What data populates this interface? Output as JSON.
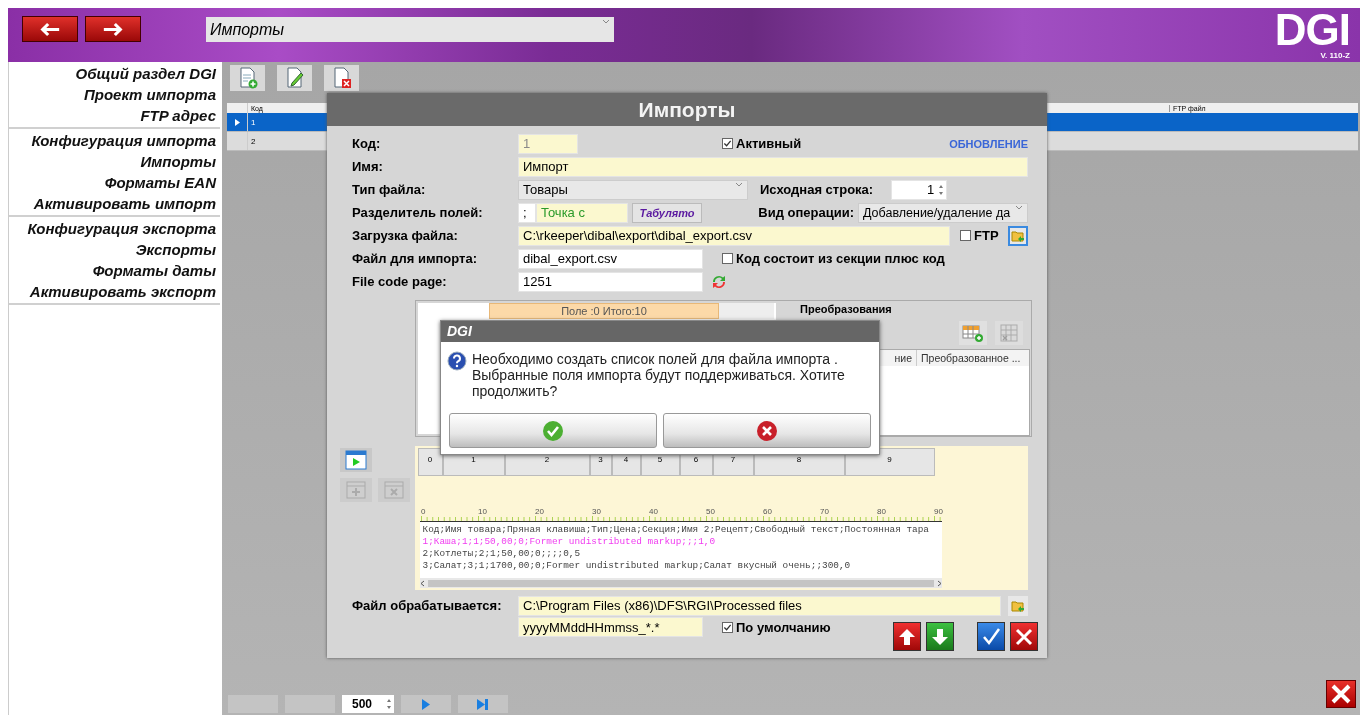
{
  "section_dropdown": {
    "value": "Импорты"
  },
  "logo": {
    "text": "DGI",
    "version": "V. 110-Z"
  },
  "sidebar": {
    "groups": [
      {
        "items": [
          "Общий раздел DGI",
          "Проект импорта",
          "FTP адрес"
        ]
      },
      {
        "items": [
          "Конфигурация импорта",
          "Импорты",
          "Форматы EAN",
          "Активировать импорт"
        ]
      },
      {
        "items": [
          "Конфигурация экспорта",
          "Экспорты",
          "Форматы даты",
          "Активировать экспорт"
        ]
      }
    ]
  },
  "grid": {
    "columns": [
      "Код",
      "FTP файл"
    ],
    "rows": [
      {
        "code": "1",
        "selected": true
      },
      {
        "code": "2",
        "selected": false
      }
    ]
  },
  "pagination": {
    "page_size": "500"
  },
  "edit_window": {
    "title": "Импорты",
    "code": {
      "label": "Код:",
      "value": "1"
    },
    "active": {
      "label": "Активный",
      "checked": true
    },
    "update_link": "ОБНОВЛЕНИЕ",
    "name": {
      "label": "Имя:",
      "value": "Импорт"
    },
    "file_type": {
      "label": "Тип файла:",
      "value": "Товары"
    },
    "start_row": {
      "label": "Исходная строка:",
      "value": "1"
    },
    "separator": {
      "label": "Разделитель полей:",
      "value": ";",
      "name": "Точка с",
      "tab_button": "Табулято"
    },
    "operation": {
      "label": "Вид операции:",
      "value": "Добавление/удаление да"
    },
    "file_load": {
      "label": "Загрузка файла:",
      "value": "C:\\rkeeper\\dibal\\export\\dibal_export.csv"
    },
    "ftp": {
      "label": "FTP",
      "checked": false
    },
    "import_file": {
      "label": "Файл для импорта:",
      "value": "dibal_export.csv"
    },
    "section_code": {
      "label": "Код состоит из секции плюс код",
      "checked": false
    },
    "code_page": {
      "label": "File code page:",
      "value": "1251"
    },
    "fields_header": "Поле :0 Итого:10",
    "transforms": {
      "title": "Преобразования",
      "columns": [
        "ние",
        "Преобразованное ..."
      ]
    },
    "column_markers": [
      "0",
      "1",
      "2",
      "3",
      "4",
      "5",
      "6",
      "7",
      "8",
      "9"
    ],
    "ruler_labels": [
      "0",
      "10",
      "20",
      "30",
      "40",
      "50",
      "60",
      "70",
      "80",
      "90"
    ],
    "preview_lines": [
      {
        "text": "Код;Имя товара;Пряная клавиша;Тип;Цена;Секция;Имя 2;Рецепт;Свободный текст;Постоянная тара",
        "highlighted": false
      },
      {
        "text": "1;Каша;1;1;50,00;0;Former undistributed markup;;;1,0",
        "highlighted": true
      },
      {
        "text": "2;Котлеты;2;1;50,00;0;;;;0,5",
        "highlighted": false
      },
      {
        "text": "3;Салат;3;1;1700,00;0;Former undistributed markup;Салат вкусный очень;;300,0",
        "highlighted": false
      }
    ],
    "processed": {
      "label": "Файл обрабатывается:",
      "value": "C:\\Program Files (x86)\\DFS\\RGI\\Processed files"
    },
    "mask": {
      "value": "yyyyMMddHHmmss_*.*"
    },
    "default": {
      "label": "По умолчанию",
      "checked": true
    }
  },
  "dialog": {
    "title": "DGI",
    "message": "Необходимо создать список полей для файла импорта . Выбранные поля импорта будут поддерживаться. Хотите продолжить?"
  }
}
